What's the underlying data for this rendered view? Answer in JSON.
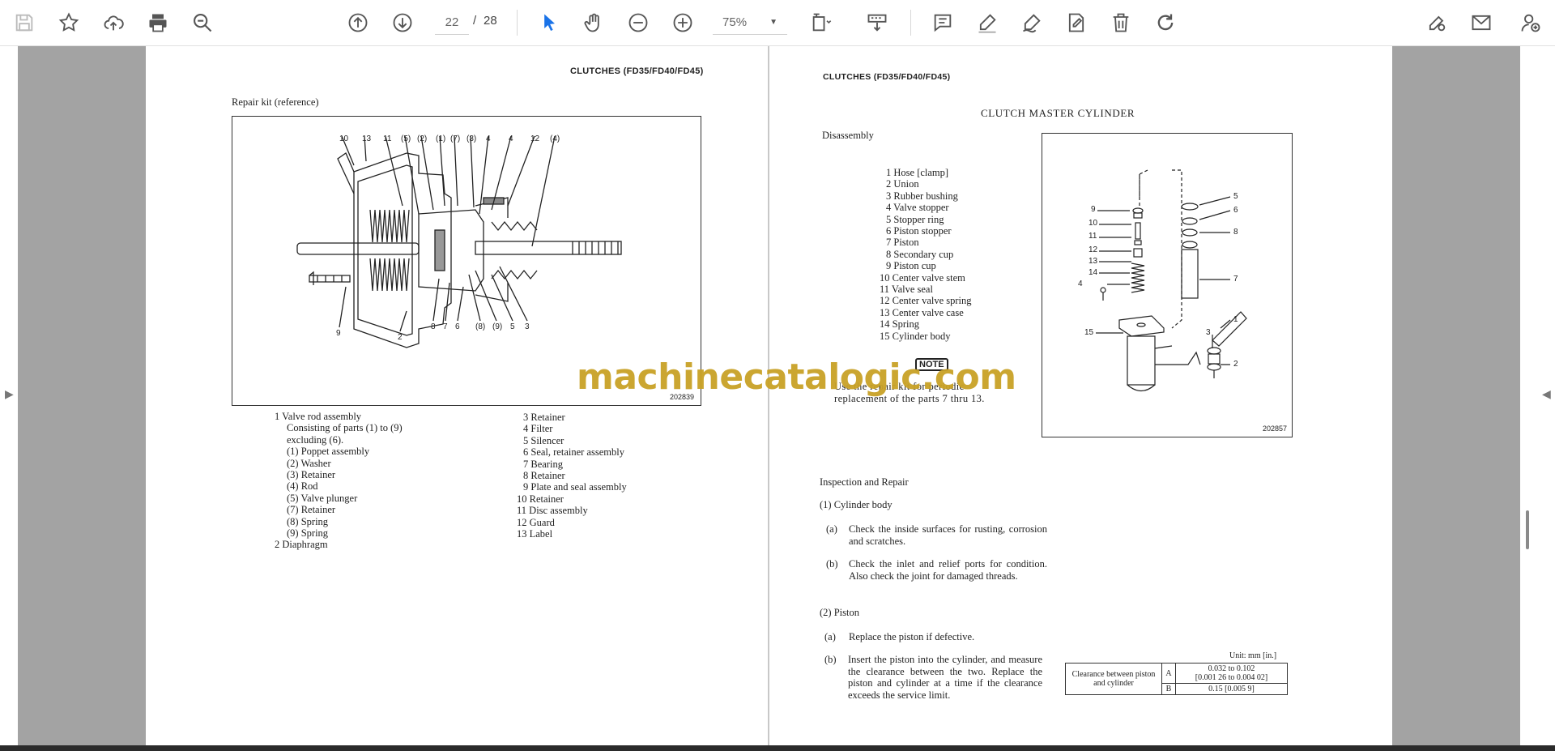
{
  "toolbar": {
    "current_page": "22",
    "page_separator": "/",
    "total_pages": "28",
    "zoom": "75%"
  },
  "watermark": "machinecatalogic.com",
  "left_page": {
    "header": "CLUTCHES (FD35/FD40/FD45)",
    "section_title": "Repair kit (reference)",
    "figure_id": "202839",
    "callouts_top": [
      "10",
      "13",
      "11",
      "(5)",
      "(2)",
      "(1)",
      "(7)",
      "(3)",
      "4",
      "4",
      "12",
      "(4)"
    ],
    "callouts_bottom": [
      "9",
      "2",
      "8",
      "7",
      "6",
      "(8)",
      "(9)",
      "5",
      "3"
    ],
    "parts_col1": [
      "1  Valve rod assembly",
      "Consisting of parts (1) to (9)",
      "excluding (6).",
      "(1)   Poppet assembly",
      "(2)   Washer",
      "(3)   Retainer",
      "(4)   Rod",
      "(5)   Valve plunger",
      "(7)   Retainer",
      "(8)   Spring",
      "(9)   Spring",
      "2  Diaphragm"
    ],
    "parts_col2": [
      "3  Retainer",
      "4  Filter",
      "5  Silencer",
      "6  Seal, retainer assembly",
      "7  Bearing",
      "8  Retainer",
      "9  Plate and seal assembly",
      "10  Retainer",
      "11  Disc assembly",
      "12  Guard",
      "13  Label"
    ]
  },
  "right_page": {
    "header": "CLUTCHES (FD35/FD40/FD45)",
    "title": "CLUTCH MASTER CYLINDER",
    "subtitle": "Disassembly",
    "parts": [
      "1  Hose [clamp]",
      "2  Union",
      "3  Rubber bushing",
      "4  Valve stopper",
      "5  Stopper ring",
      "6  Piston stopper",
      "7  Piston",
      "8  Secondary cup",
      "9  Piston cup",
      "10  Center valve stem",
      "11  Valve seal",
      "12  Center valve spring",
      "13  Center valve case",
      "14  Spring",
      "15  Cylinder body"
    ],
    "note_label": "NOTE",
    "note_line1": "Use the repair kit for periodic",
    "note_line2": "replacement of the parts 7 thru 13.",
    "figure_id": "202857",
    "fig_labels": [
      "9",
      "10",
      "11",
      "12",
      "13",
      "14",
      "4",
      "15",
      "5",
      "6",
      "8",
      "7",
      "1",
      "3",
      "2"
    ],
    "inspection_title": "Inspection and Repair",
    "item1": "(1)   Cylinder body",
    "item1a_label": "(a)",
    "item1a_text": "Check the inside surfaces for rusting, corrosion and scratches.",
    "item1b_label": "(b)",
    "item1b_text": "Check the inlet and relief ports for condition. Also check the joint for damaged threads.",
    "item2": "(2)   Piston",
    "item2a_label": "(a)",
    "item2a_text": "Replace the piston if defective.",
    "item2b_label": "(b)",
    "item2b_text": "Insert the piston into the cylinder, and measure the clearance between the two.  Replace the piston and cylinder at a time if the clearance exceeds the service limit.",
    "table_unit": "Unit: mm [in.]",
    "table_label": "Clearance between piston and cylinder",
    "row_a_key": "A",
    "row_a_val1": "0.032 to 0.102",
    "row_a_val2": "[0.001 26 to 0.004 02]",
    "row_b_key": "B",
    "row_b_val": "0.15 [0.005 9]"
  }
}
